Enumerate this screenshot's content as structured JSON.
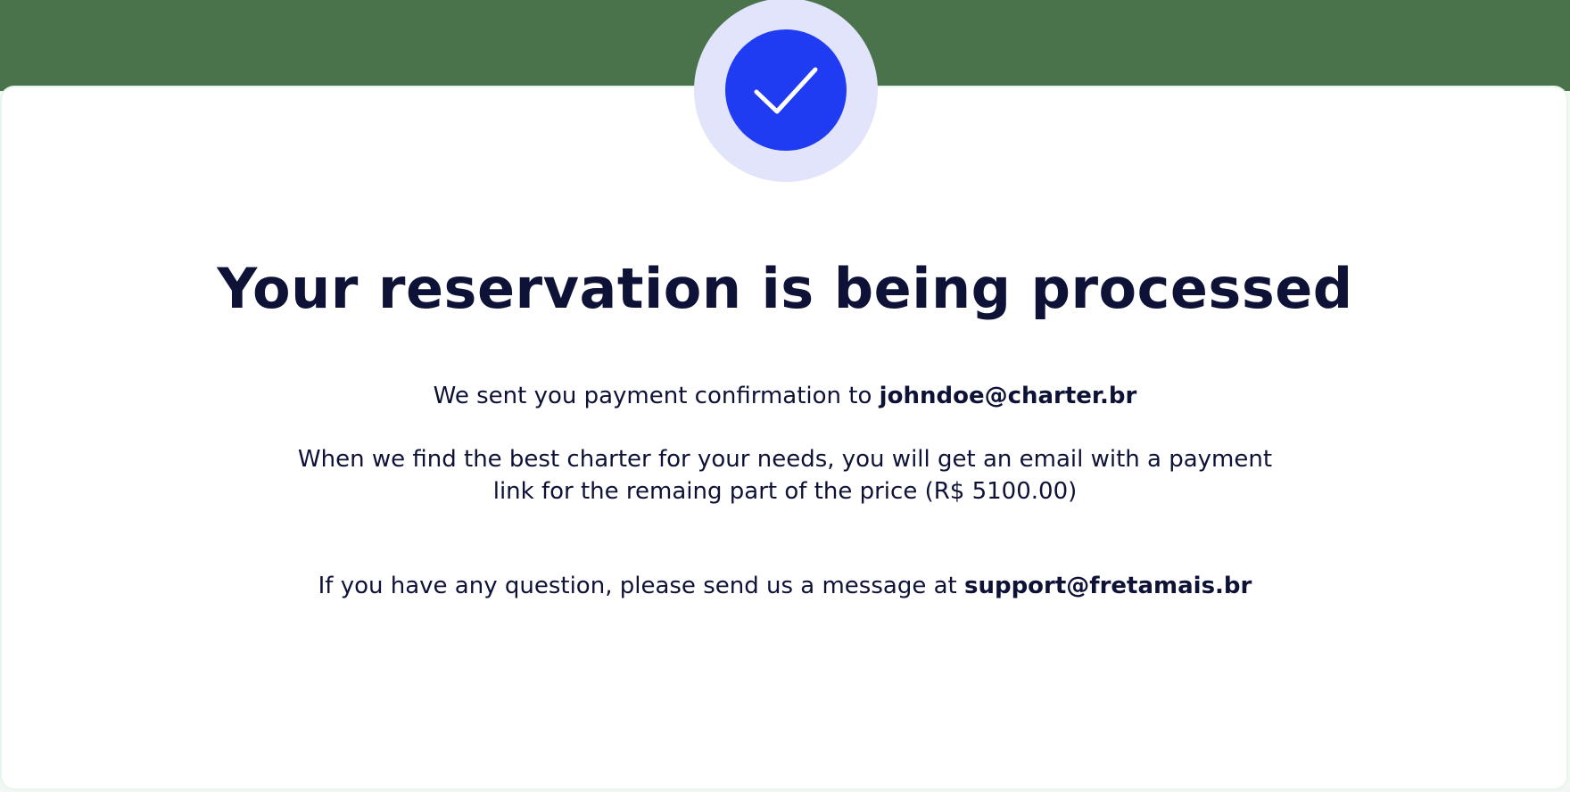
{
  "header": {
    "status_icon": "checkmark-icon",
    "colors": {
      "band": "#4a734b",
      "halo": "#e1e4fb",
      "circle": "#1f3cf3",
      "text": "#0e1236"
    }
  },
  "confirmation": {
    "title": "Your reservation is being processed",
    "sent_prefix": "We sent you payment confirmation to ",
    "email": "johndoe@charter.br",
    "payment_line_1": "When we find the best charter for your needs, you will get an email with a payment",
    "payment_line_2": "link for the remaing part of the price (R$ 5100.00)",
    "support_prefix": "If you have any question, please send us a message at ",
    "support_email": "support@fretamais.br"
  }
}
